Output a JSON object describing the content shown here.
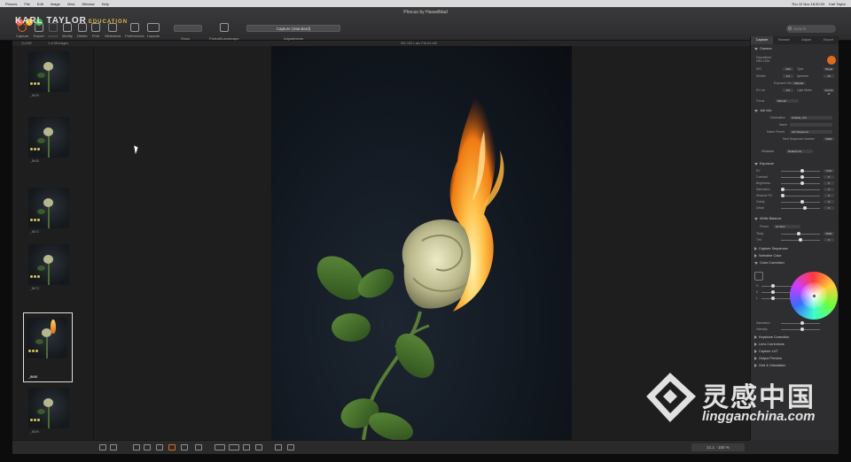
{
  "menubar": {
    "items": [
      "Phocus",
      "File",
      "Edit",
      "Image",
      "View",
      "Window",
      "Help"
    ],
    "clock": "Thu 12 Nov 18:30:03",
    "user": "Karl Taylor"
  },
  "window": {
    "title": "Phocus by Hasselblad"
  },
  "brand": {
    "name": "KARL TAYLOR",
    "sub": "EDUCATION"
  },
  "toolbar": {
    "buttons": [
      "Capture",
      "Export",
      "Import",
      "Modify",
      "Delete",
      "Print",
      "Slideshow",
      "Preferences",
      "Layouts"
    ],
    "show_label": "Show",
    "show_value": "",
    "portrait_label": "Portrait/Landscape",
    "adjustments_value": "Capture (Standard)",
    "adjustments_label": "Adjustments",
    "search_placeholder": "Search",
    "search_label": "Search"
  },
  "subbar": {
    "left": "CLOSE",
    "count": "1 of 98 images",
    "info": "ISO 100 1 sec F16 f/4 100"
  },
  "browser": {
    "thumbs": [
      {
        "caption": "_B639",
        "burning": false,
        "selected": false
      },
      {
        "caption": "_B645",
        "burning": false,
        "selected": false
      },
      {
        "caption": "_B672",
        "burning": false,
        "selected": false
      },
      {
        "caption": "_B673",
        "burning": false,
        "selected": false
      },
      {
        "caption": "_B698",
        "burning": true,
        "selected": true
      },
      {
        "caption": "_B699",
        "burning": false,
        "selected": false
      }
    ]
  },
  "panel": {
    "tabs": [
      "Capture",
      "Browse",
      "Adjust",
      "Export"
    ],
    "active_tab": "Capture",
    "camera_title": "Camera",
    "camera_name": "Hasselblad",
    "camera_model": "H6D-100c",
    "camera_rows": [
      {
        "label": "ISO",
        "value": "100"
      },
      {
        "label": "Shutter",
        "value": "1/1"
      },
      {
        "label": "Exposure Mode",
        "value": "Manual"
      },
      {
        "label": "EV cor",
        "value": "0.0"
      }
    ],
    "camera_right_rows": [
      {
        "label": "Type",
        "value": "Single"
      },
      {
        "label": "Aperture",
        "value": "16"
      },
      {
        "label": "Light Meter",
        "value": "Centre W"
      }
    ],
    "focus_label": "Focus",
    "focus_value": "Manual",
    "job": {
      "title": "Job Info",
      "rows": [
        {
          "label": "Destination",
          "value": "Untitled_Job"
        },
        {
          "label": "Name",
          "value": ""
        },
        {
          "label": "Name Preset",
          "value": "Job Sequence"
        },
        {
          "label": "Next Sequence Number",
          "value": "0699"
        }
      ],
      "metadata_label": "Metadata",
      "metadata_value": "Default Info"
    },
    "exposure": {
      "title": "Exposure",
      "rows": [
        {
          "label": "EV",
          "level": 0.55,
          "value": "0.00"
        },
        {
          "label": "Contrast",
          "level": 0.55,
          "value": "0"
        },
        {
          "label": "Brightness",
          "level": 0.55,
          "value": "0"
        },
        {
          "label": "Saturation",
          "level": 0.05,
          "value": "0"
        },
        {
          "label": "Shadow Fill",
          "level": 0.05,
          "value": "0"
        },
        {
          "label": "Clarity",
          "level": 0.55,
          "value": "0"
        },
        {
          "label": "Detail",
          "level": 0.62,
          "value": "0"
        }
      ]
    },
    "white_balance": {
      "title": "White Balance",
      "preset_label": "Preset",
      "preset_value": "As Shot",
      "rows": [
        {
          "label": "Temp",
          "level": 0.45,
          "value": "5000"
        },
        {
          "label": "Tint",
          "level": 0.5,
          "value": "0"
        }
      ]
    },
    "collapsed_sections": [
      "Capture Sequencer",
      "Selective Color",
      "Base Characteristics",
      "Color Correction"
    ],
    "color_rows": [
      {
        "label": "H",
        "level": 0.3
      },
      {
        "label": "S",
        "level": 0.3
      },
      {
        "label": "L",
        "level": 0.3
      }
    ],
    "color_bottom_rows": [
      {
        "label": "Saturation",
        "level": 0.55
      },
      {
        "label": "Intensity",
        "level": 0.55
      }
    ],
    "lower_sections": [
      "Keystone Correction",
      "Lens Corrections",
      "Capture LUT",
      "Output Preview",
      "Grid & Orientation"
    ]
  },
  "viewer": {
    "zoom_readout": "21.1 · 100 %"
  },
  "watermark": {
    "logo_cn": "灵感中国",
    "logo_en": "lingganchina.com"
  },
  "colors": {
    "accent": "#e26a1b",
    "panel_bg": "#2e2e30",
    "toolbar_bg": "#333335",
    "star": "#d6c55a"
  }
}
